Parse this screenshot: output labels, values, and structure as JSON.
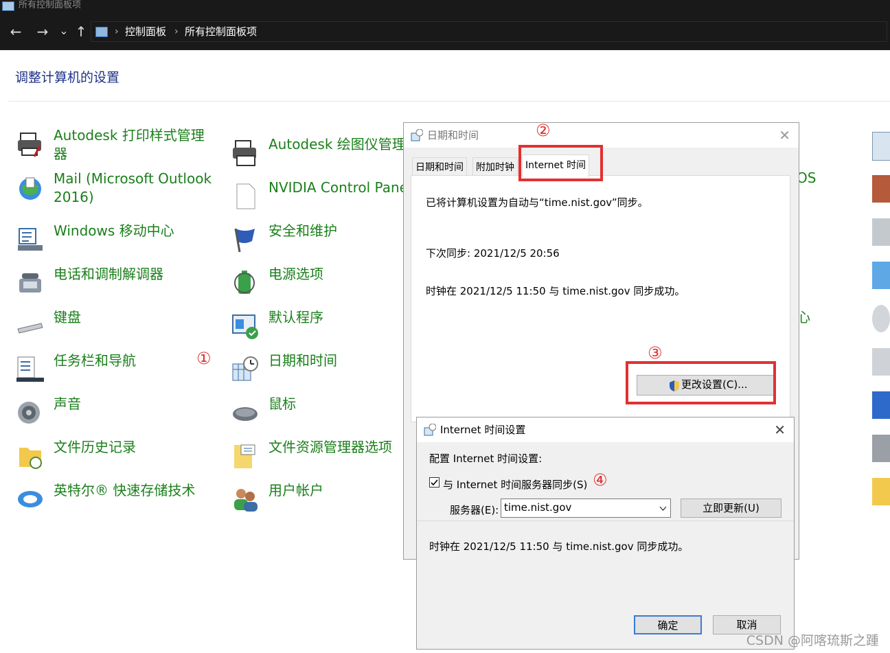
{
  "window": {
    "title": "所有控制面板项"
  },
  "nav": {
    "back": "←",
    "forward": "→",
    "dropdown": "⌄",
    "up": "↑",
    "separator": "›",
    "breadcrumb": [
      "控制面板",
      "所有控制面板项"
    ]
  },
  "page": {
    "heading": "调整计算机的设置"
  },
  "items": [
    {
      "label": "Autodesk 打印样式管理器"
    },
    {
      "label": "Autodesk 绘图仪管理"
    },
    {
      "label": "Mail (Microsoft Outlook 2016)"
    },
    {
      "label": "NVIDIA Control Pane"
    },
    {
      "label": "Windows 移动中心"
    },
    {
      "label": "安全和维护"
    },
    {
      "label": "电话和调制解调器"
    },
    {
      "label": "电源选项"
    },
    {
      "label": "键盘"
    },
    {
      "label": "默认程序"
    },
    {
      "label": "任务栏和导航"
    },
    {
      "label": "日期和时间"
    },
    {
      "label": "声音"
    },
    {
      "label": "鼠标"
    },
    {
      "label": "文件历史记录"
    },
    {
      "label": "文件资源管理器选项"
    },
    {
      "label": "英特尔® 快速存储技术"
    },
    {
      "label": "用户帐户"
    }
  ],
  "partial": {
    "os": "OS",
    "xin": "心"
  },
  "markers": {
    "m1": "①",
    "m2": "②",
    "m3": "③",
    "m4": "④"
  },
  "datetime_dialog": {
    "title": "日期和时间",
    "close": "✕",
    "tabs": [
      "日期和时间",
      "附加时钟",
      "Internet 时间"
    ],
    "sync_info": "已将计算机设置为自动与“time.nist.gov”同步。",
    "next_sync": "下次同步: 2021/12/5 20:56",
    "last_sync": "时钟在 2021/12/5 11:50 与 time.nist.gov 同步成功。",
    "change_button": "更改设置(C)..."
  },
  "internet_dialog": {
    "title": "Internet 时间设置",
    "close": "✕",
    "config_label": "配置 Internet 时间设置:",
    "checkbox_label": "与 Internet 时间服务器同步(S)",
    "checked": true,
    "server_label": "服务器(E):",
    "server_value": "time.nist.gov",
    "update_button": "立即更新(U)",
    "status": "时钟在 2021/12/5 11:50 与 time.nist.gov 同步成功。",
    "ok_button": "确定",
    "cancel_button": "取消"
  },
  "watermark": "CSDN @阿喀琉斯之踵",
  "colors": {
    "link_green": "#1a7f1a",
    "heading_blue": "#1e3287",
    "annotation_red": "#e23030",
    "title_dark": "#191919"
  }
}
